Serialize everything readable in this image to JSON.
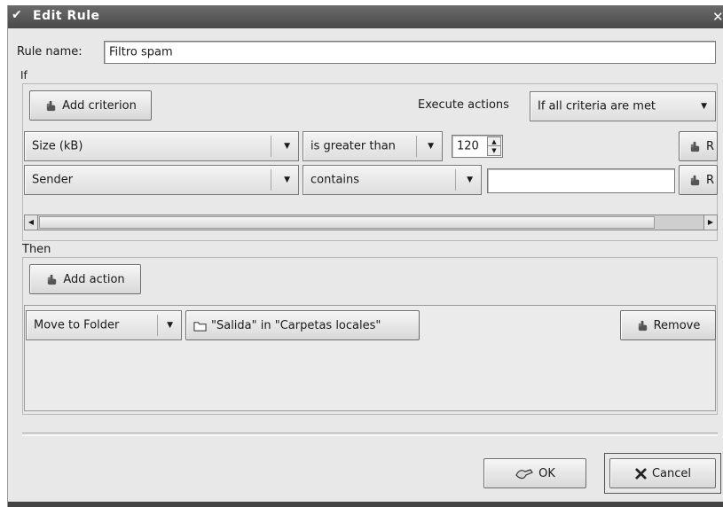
{
  "window": {
    "title": "Edit Rule"
  },
  "rule_name": {
    "label": "Rule name:",
    "value": "Filtro spam"
  },
  "if_section": {
    "label": "If",
    "add_criterion_label": "Add criterion",
    "execute_actions_label": "Execute actions",
    "execute_actions_value": "If all criteria are met",
    "criteria": [
      {
        "field": "Size (kB)",
        "operator": "is greater than",
        "value": "120",
        "remove_label": "R"
      },
      {
        "field": "Sender",
        "operator": "contains",
        "value": "",
        "remove_label": "R"
      }
    ]
  },
  "then_section": {
    "label": "Then",
    "add_action_label": "Add action",
    "actions": [
      {
        "type": "Move to Folder",
        "target": "\"Salida\" in \"Carpetas locales\"",
        "remove_label": "Remove"
      }
    ]
  },
  "buttons": {
    "ok_label": "OK",
    "cancel_label": "Cancel"
  },
  "icons": {
    "add": "hand-icon",
    "folder": "folder-icon",
    "ok": "ok-icon",
    "cancel": "cancel-x-icon"
  }
}
